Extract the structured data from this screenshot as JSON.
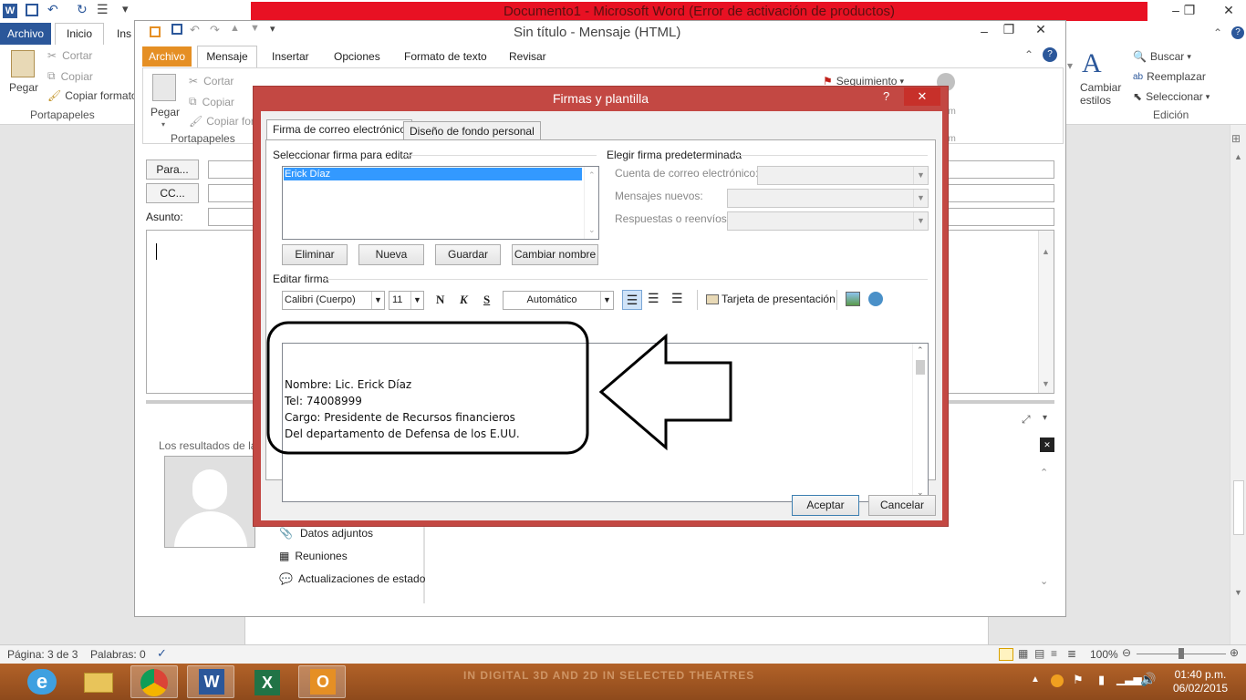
{
  "word": {
    "title": "Documento1 - Microsoft Word (Error de activación de productos)",
    "tabs": {
      "archivo": "Archivo",
      "inicio": "Inicio",
      "ins": "Ins"
    },
    "ribbon": {
      "pegar": "Pegar",
      "cortar": "Cortar",
      "copiar": "Copiar",
      "copiar_formato": "Copiar formato",
      "portapapeles": "Portapapeles",
      "buscar": "Buscar",
      "reemplazar": "Reemplazar",
      "seleccionar": "Seleccionar",
      "cambiar": "Cambiar",
      "estilos": "estilos",
      "edicion": "Edición"
    },
    "status": {
      "pagina": "Página: 3 de 3",
      "palabras": "Palabras: 0",
      "zoom": "100%"
    }
  },
  "outlook": {
    "title": "Sin título - Mensaje (HTML)",
    "tabs": [
      "Archivo",
      "Mensaje",
      "Insertar",
      "Opciones",
      "Formato de texto",
      "Revisar"
    ],
    "ribbon": {
      "pegar": "Pegar",
      "cortar": "Cortar",
      "copiar": "Copiar",
      "copiar_formato": "Copiar for",
      "portapapeles": "Portapapeles",
      "seguimiento": "Seguimiento",
      "om1": "om",
      "om2": "om"
    },
    "form": {
      "para": "Para...",
      "cc": "CC...",
      "asunto": "Asunto:"
    },
    "people": {
      "results": "Los resultados de la",
      "items": [
        "Datos adjuntos",
        "Reuniones",
        "Actualizaciones de estado"
      ]
    }
  },
  "dialog": {
    "title": "Firmas y plantilla",
    "help": "?",
    "close": "✕",
    "tabs": [
      "Firma de correo electrónico",
      "Diseño de fondo personal"
    ],
    "select_label": "Seleccionar firma para editar",
    "signatures": [
      "Erick Díaz"
    ],
    "buttons": {
      "eliminar": "Eliminar",
      "nueva": "Nueva",
      "guardar": "Guardar",
      "cambiar_nombre": "Cambiar nombre"
    },
    "default_label": "Elegir firma predeterminada",
    "cuenta_label": "Cuenta de correo electrónico:",
    "nuevos_label": "Mensajes nuevos:",
    "respuestas_label": "Respuestas o reenvíos:",
    "edit_label": "Editar firma",
    "toolbar": {
      "font": "Calibri (Cuerpo)",
      "size": "11",
      "bold": "N",
      "italic": "K",
      "underline": "S",
      "color": "Automático",
      "tarjeta": "Tarjeta de presentación"
    },
    "signature_lines": [
      "Nombre:  Lic. Erick Díaz",
      "Tel: 74008999",
      "Cargo: Presidente de Recursos financieros",
      "Del departamento de Defensa de los E.UU."
    ],
    "aceptar": "Aceptar",
    "cancelar": "Cancelar"
  },
  "taskbar": {
    "promo": "IN DIGITAL 3D AND 2D IN SELECTED THEATRES",
    "time": "01:40 p.m.",
    "date": "06/02/2015"
  },
  "colors": {
    "word_blue": "#2b579a",
    "outlook_orange": "#e58f24",
    "dialog_red": "#c34843",
    "error_red": "#e81123"
  }
}
